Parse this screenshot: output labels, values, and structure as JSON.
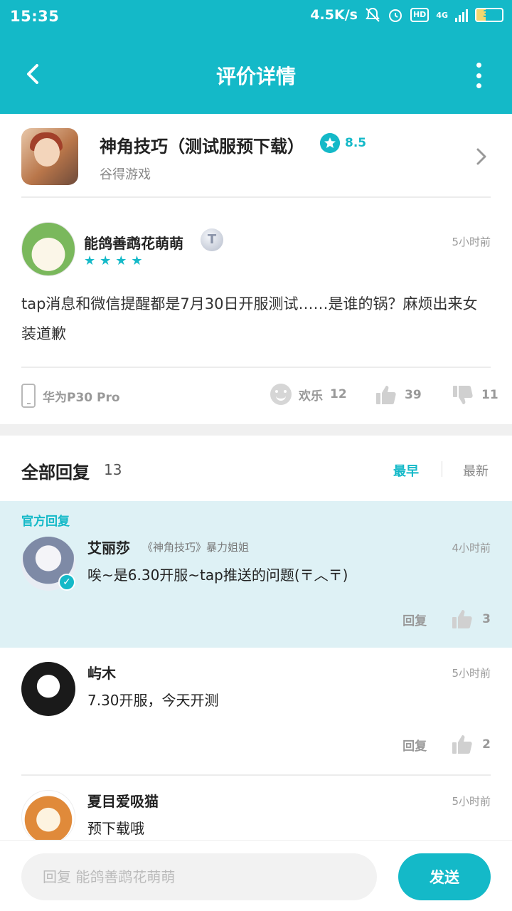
{
  "status_bar": {
    "time": "15:35",
    "network_speed": "4.5K/s",
    "hd_label": "HD",
    "network_type": "4G",
    "battery": "37"
  },
  "header": {
    "title": "评价详情"
  },
  "game": {
    "name": "神角技巧（测试服预下载）",
    "rating": "8.5",
    "developer": "谷得游戏"
  },
  "review": {
    "author": "能鸽善鹉花萌萌",
    "level_badge": "T",
    "star_count": 4,
    "time": "5小时前",
    "text": "tap消息和微信提醒都是7月30日开服测试……是谁的锅？麻烦出来女装道歉",
    "device": "华为P30 Pro",
    "mood_label": "欢乐",
    "mood_count": "12",
    "likes": "39",
    "dislikes": "11"
  },
  "replies_header": {
    "title": "全部回复",
    "count": "13",
    "sort_earliest": "最早",
    "sort_latest": "最新"
  },
  "official_reply": {
    "label": "官方回复",
    "author": "艾丽莎",
    "author_title": "《神角技巧》暴力姐姐",
    "time": "4小时前",
    "text": "唉~是6.30开服~tap推送的问题(〒︿〒)",
    "reply_label": "回复",
    "likes": "3"
  },
  "replies": [
    {
      "author": "屿木",
      "time": "5小时前",
      "text": "7.30开服，今天开测",
      "reply_label": "回复",
      "likes": "2"
    },
    {
      "author": "夏目爱吸猫",
      "time": "5小时前",
      "text": "预下载哦"
    }
  ],
  "bottom_bar": {
    "input_placeholder": "回复 能鸽善鹉花萌萌",
    "send_label": "发送"
  },
  "colors": {
    "accent": "#14b9c8",
    "official_bg": "#def1f5"
  }
}
